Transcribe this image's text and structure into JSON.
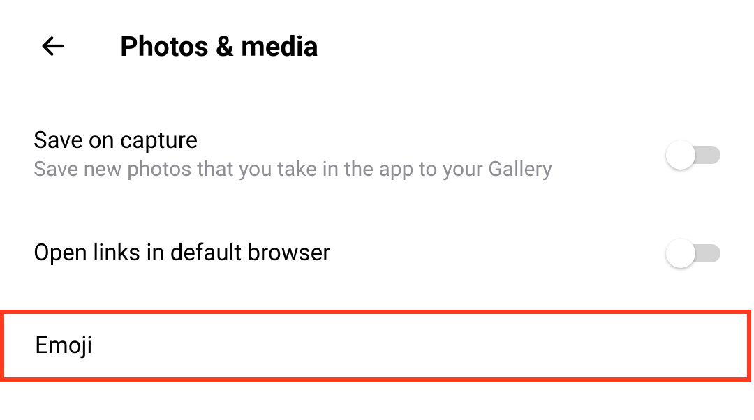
{
  "header": {
    "title": "Photos & media"
  },
  "settings": {
    "saveOnCapture": {
      "title": "Save on capture",
      "subtitle": "Save new photos that you take in the app to your Gallery",
      "enabled": false
    },
    "openLinks": {
      "title": "Open links in default browser",
      "enabled": false
    },
    "emoji": {
      "title": "Emoji"
    }
  }
}
